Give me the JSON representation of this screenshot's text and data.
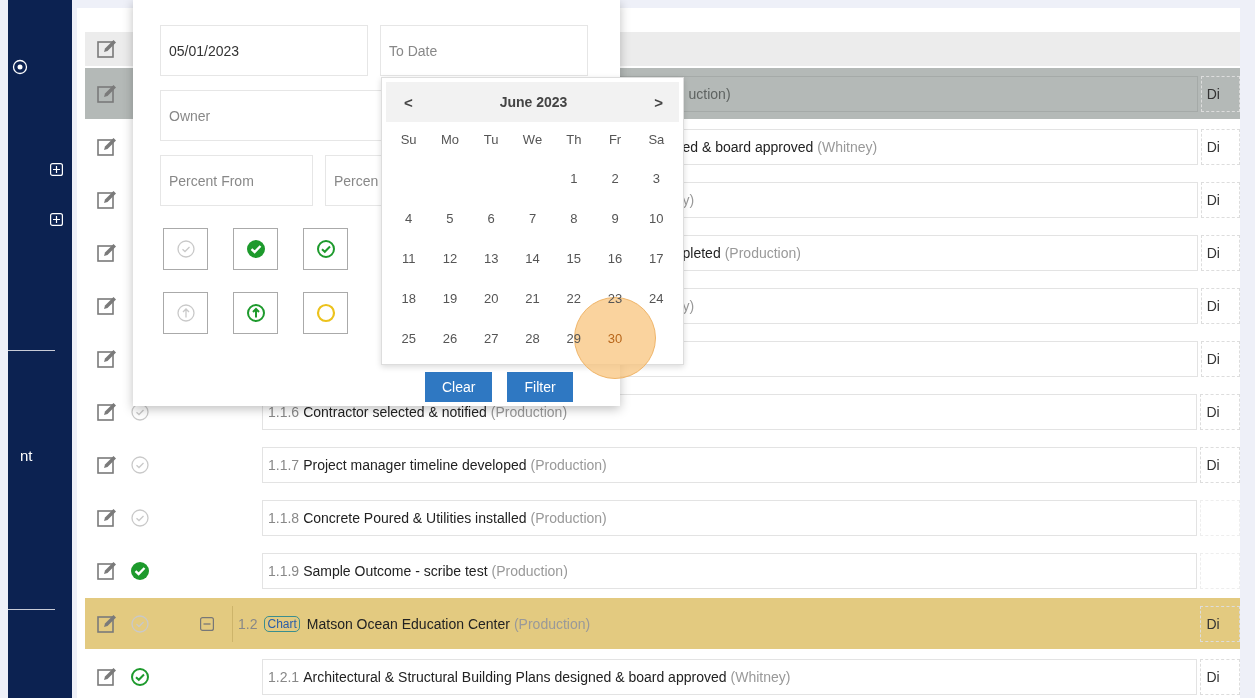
{
  "sidebar": {
    "text": "nt"
  },
  "table": {
    "rows": [
      {
        "kind": "toolbar",
        "selected": false
      },
      {
        "kind": "covered-parent",
        "selected": false,
        "owner": "uction)",
        "column_5": "Di"
      },
      {
        "kind": "covered",
        "selected": false,
        "title": "ed & board approved",
        "owner": "(Whitney)",
        "column_5": "Di"
      },
      {
        "kind": "covered",
        "selected": false,
        "owner": "y)",
        "column_5": "Di"
      },
      {
        "kind": "covered",
        "selected": false,
        "title": "pleted",
        "owner": "(Production)",
        "column_5": "Di"
      },
      {
        "kind": "covered",
        "selected": false,
        "owner": "y)",
        "column_5": "Di"
      },
      {
        "kind": "covered",
        "selected": false,
        "column_5": "Di"
      },
      {
        "kind": "task",
        "selected": false,
        "status_icon": {
          "kind": "open"
        },
        "number": "1.1.6",
        "title": "Contractor selected & notified",
        "owner": "(Production)",
        "column_5": "Di"
      },
      {
        "kind": "task",
        "selected": false,
        "status_icon": {
          "kind": "open"
        },
        "number": "1.1.7",
        "title": "Project manager timeline developed",
        "owner": "(Production)",
        "column_5": "Di"
      },
      {
        "kind": "task",
        "selected": false,
        "status_icon": {
          "kind": "open"
        },
        "number": "1.1.8",
        "title": "Concrete Poured & Utilities installed",
        "owner": "(Production)"
      },
      {
        "kind": "task",
        "selected": false,
        "status_icon": {
          "kind": "done"
        },
        "number": "1.1.9",
        "title": "Sample Outcome - scribe test",
        "owner": "(Production)"
      },
      {
        "kind": "group",
        "selected": true,
        "status_icon": {
          "kind": "open"
        },
        "expanded": true,
        "number": "1.2",
        "badge": "Chart",
        "title": "Matson Ocean Education Center",
        "owner": "(Production)",
        "column_5": "Di"
      },
      {
        "kind": "task",
        "selected": false,
        "status_icon": {
          "kind": "complete"
        },
        "number": "1.2.1",
        "title": "Architectural & Structural Building Plans designed & board approved",
        "owner": "(Whitney)",
        "column_5": "Di"
      }
    ]
  },
  "filter_popup": {
    "fields": [
      {
        "kind": "date",
        "value": "05/01/2023"
      },
      {
        "kind": "date",
        "placeholder": "To Date"
      },
      {
        "kind": "wide",
        "placeholder": "Owner"
      },
      {
        "kind": "number",
        "placeholder": "Percent From"
      },
      {
        "kind": "number",
        "placeholder": "Percen"
      }
    ],
    "status_buttons": [
      {
        "kind": "open"
      },
      {
        "kind": "done"
      },
      {
        "kind": "complete"
      },
      {
        "kind": "open-up"
      },
      {
        "kind": "up"
      },
      {
        "kind": "pending"
      }
    ],
    "buttons": [
      "Clear",
      "Filter"
    ],
    "calendar": {
      "prev": "<",
      "month": "June 2023",
      "next": ">",
      "weekdays": [
        "Su",
        "Mo",
        "Tu",
        "We",
        "Th",
        "Fr",
        "Sa"
      ],
      "weeks": [
        [
          {
            "day": "1",
            "marked": false
          },
          {
            "day": "2",
            "marked": false
          },
          {
            "day": "3",
            "marked": false
          }
        ],
        [
          {
            "day": "4",
            "marked": false
          },
          {
            "day": "5",
            "marked": false
          },
          {
            "day": "6",
            "marked": false
          },
          {
            "day": "7",
            "marked": false
          },
          {
            "day": "8",
            "marked": false
          },
          {
            "day": "9",
            "marked": false
          },
          {
            "day": "10",
            "marked": false
          }
        ],
        [
          {
            "day": "11",
            "marked": false
          },
          {
            "day": "12",
            "marked": false
          },
          {
            "day": "13",
            "marked": false
          },
          {
            "day": "14",
            "marked": false
          },
          {
            "day": "15",
            "marked": false
          },
          {
            "day": "16",
            "marked": false
          },
          {
            "day": "17",
            "marked": false
          }
        ],
        [
          {
            "day": "18",
            "marked": false
          },
          {
            "day": "19",
            "marked": false
          },
          {
            "day": "20",
            "marked": false
          },
          {
            "day": "21",
            "marked": false
          },
          {
            "day": "22",
            "marked": false
          },
          {
            "day": "23",
            "marked": false
          },
          {
            "day": "24",
            "marked": false
          }
        ],
        [
          {
            "day": "25",
            "marked": false
          },
          {
            "day": "26",
            "marked": false
          },
          {
            "day": "27",
            "marked": false
          },
          {
            "day": "28",
            "marked": false
          },
          {
            "day": "29",
            "marked": false
          },
          {
            "day": "30",
            "marked": true
          }
        ]
      ]
    }
  }
}
